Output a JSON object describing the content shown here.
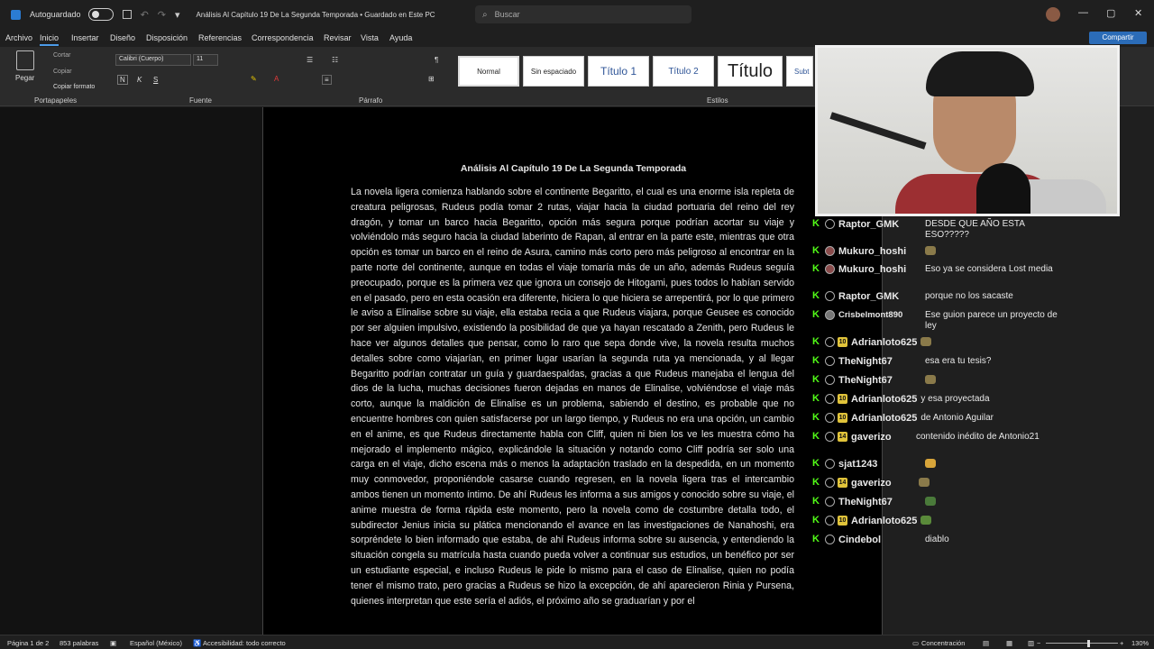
{
  "titlebar": {
    "autosave_label": "Autoguardado",
    "doc_title": "Análisis Al Capítulo 19 De La Segunda Temporada • Guardado en Este PC",
    "search_placeholder": "Buscar",
    "minimize": "—",
    "maximize": "▢",
    "close": "✕"
  },
  "menu": [
    "Archivo",
    "Inicio",
    "Insertar",
    "Diseño",
    "Disposición",
    "Referencias",
    "Correspondencia",
    "Revisar",
    "Vista",
    "Ayuda"
  ],
  "share_label": "Compartir",
  "ribbon": {
    "paste": "Pegar",
    "cut": "Cortar",
    "copy": "Copiar",
    "format_painter": "Copiar formato",
    "font_name": "Calibri (Cuerpo)",
    "font_size": "11",
    "group_clipboard": "Portapapeles",
    "group_font": "Fuente",
    "group_paragraph": "Párrafo",
    "group_styles": "Estilos",
    "styles": [
      "Normal",
      "Sin espaciado",
      "Título 1",
      "Título 2",
      "Título",
      "Subt"
    ]
  },
  "document": {
    "title": "Análisis Al Capítulo 19 De La Segunda Temporada",
    "body": "La novela ligera comienza hablando sobre el continente Begaritto, el cual es una enorme isla repleta de creatura peligrosas, Rudeus podía tomar 2 rutas, viajar hacia la ciudad portuaria del reino del rey dragón, y tomar un barco hacia Begaritto, opción más segura porque podrían acortar su viaje y volviéndolo más seguro hacia la ciudad laberinto de Rapan, al entrar en la parte este, mientras que otra opción es tomar un barco en el reino de Asura, camino más corto pero más peligroso al encontrar en la parte norte del continente, aunque en todas el viaje tomaría más de un año, además Rudeus seguía preocupado, porque es la primera vez que ignora un consejo de Hitogami, pues todos lo habían servido en el pasado, pero en esta ocasión era diferente, hiciera lo que hiciera se arrepentirá, por lo que primero le aviso a Elinalise sobre su viaje, ella estaba recia a que Rudeus viajara, porque Geusee es conocido por ser alguien impulsivo, existiendo la posibilidad de que ya hayan rescatado a Zenith, pero Rudeus le hace ver algunos detalles que pensar, como lo raro que sepa donde vive, la novela resulta muchos detalles sobre como viajarían, en primer lugar usarían la segunda ruta ya mencionada, y al llegar Begaritto podrían contratar un guía y guardaespaldas, gracias a que Rudeus manejaba el lengua del dios de la lucha, muchas decisiones fueron dejadas en manos de Elinalise, volviéndose el viaje más corto, aunque la maldición de Elinalise es un problema, sabiendo el destino, es probable que no encuentre hombres con quien satisfacerse por un largo tiempo, y Rudeus no era una opción, un cambio en el anime, es que Rudeus directamente habla con Cliff, quien ni bien los ve les muestra cómo ha mejorado el implemento mágico, explicándole la situación y notando como Cliff podría ser solo una carga en el viaje, dicho escena más o menos la adaptación traslado en la despedida, en un momento muy conmovedor, proponiéndole casarse cuando regresen, en la novela ligera tras el intercambio ambos tienen un momento íntimo. De ahí Rudeus les informa a sus amigos y conocido sobre su viaje, el anime muestra de forma rápida este momento, pero la novela como de costumbre detalla todo, el subdirector Jenius inicia su plática mencionando el avance en las investigaciones de Nanahoshi, era sorpréndete lo bien informado que estaba, de ahí Rudeus informa sobre su ausencia, y entendiendo la situación congela su matrícula hasta cuando pueda volver a continuar sus estudios, un benéfico por ser un estudiante especial, e incluso Rudeus le pide lo mismo para el caso de Elinalise, quien no podía tener el mismo trato, pero gracias a Rudeus se hizo la excepción, de ahí aparecieron Rinia y Pursena, quienes interpretan que este sería el adiós, el próximo año se graduarían y por el"
  },
  "chat": [
    {
      "user": "Raptor_GMK",
      "badge": "",
      "avatar": "person-icon",
      "text": "DESDE QUE AÑO ESTA ESO?????"
    },
    {
      "user": "Mukuro_hoshi",
      "badge": "",
      "avatar": "user-avatar",
      "text": "",
      "emote": "emote-icon"
    },
    {
      "user": "Mukuro_hoshi",
      "badge": "",
      "avatar": "user-avatar",
      "text": "Eso ya se considera Lost media"
    },
    {
      "user": "Raptor_GMK",
      "badge": "",
      "avatar": "person-icon",
      "text": "porque no los sacaste"
    },
    {
      "user": "Crisbelmont890",
      "badge": "",
      "avatar": "user-avatar",
      "text": "Ese guion parece un proyecto de ley"
    },
    {
      "user": "Adrianloto625",
      "badge": "10",
      "avatar": "person-icon",
      "text": "",
      "emote": "emote-icon"
    },
    {
      "user": "TheNight67",
      "badge": "",
      "avatar": "person-icon",
      "text": "esa era tu tesis?"
    },
    {
      "user": "TheNight67",
      "badge": "",
      "avatar": "person-icon",
      "text": "",
      "emote": "emote-icon"
    },
    {
      "user": "Adrianloto625",
      "badge": "10",
      "avatar": "person-icon",
      "text": "y esa proyectada"
    },
    {
      "user": "Adrianloto625",
      "badge": "10",
      "avatar": "person-icon",
      "text": "de Antonio Aguilar"
    },
    {
      "user": "gaverizo",
      "badge": "14",
      "avatar": "person-icon",
      "text": "contenido inédito de Antonio21"
    },
    {
      "user": "sjat1243",
      "badge": "",
      "avatar": "person-icon",
      "text": "",
      "emote": "emote-icon"
    },
    {
      "user": "gaverizo",
      "badge": "14",
      "avatar": "person-icon",
      "text": "",
      "emote": "emote-icon"
    },
    {
      "user": "TheNight67",
      "badge": "",
      "avatar": "person-icon",
      "text": "",
      "emote": "emote-icon"
    },
    {
      "user": "Adrianloto625",
      "badge": "10",
      "avatar": "person-icon",
      "text": "",
      "emote": "emote-icon"
    },
    {
      "user": "Cindebol",
      "badge": "",
      "avatar": "person-icon",
      "text": "diablo"
    }
  ],
  "status": {
    "page": "Página 1 de 2",
    "words": "853 palabras",
    "language": "Español (México)",
    "accessibility": "Accesibilidad: todo correcto",
    "focus": "Concentración",
    "zoom": "130%",
    "zoom_fraction": 0.58
  }
}
